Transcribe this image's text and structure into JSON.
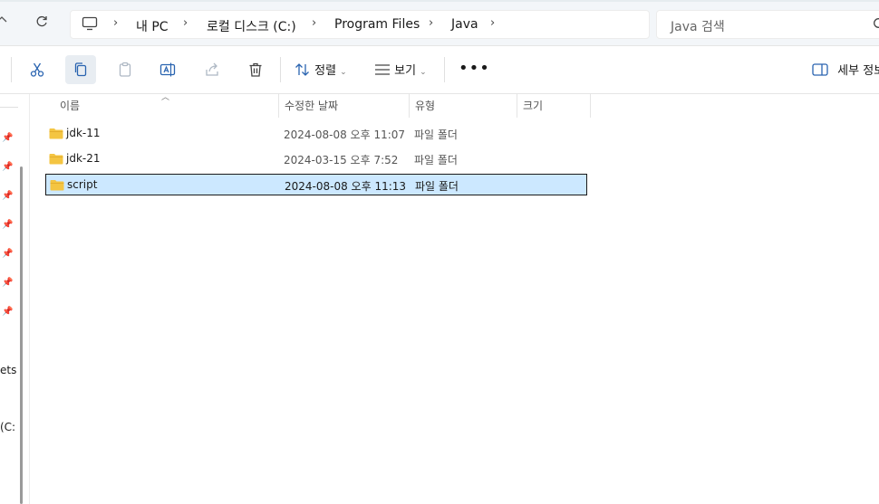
{
  "address_bar": {
    "crumbs": [
      "내 PC",
      "로컬 디스크 (C:)",
      "Program Files",
      "Java"
    ]
  },
  "search": {
    "placeholder": "Java 검색"
  },
  "toolbar": {
    "sort_label": "정렬",
    "view_label": "보기",
    "more_label": "•••",
    "details_label": "세부 정보"
  },
  "left_nav": {
    "fragments": [
      "ets",
      "(C:"
    ]
  },
  "columns": {
    "name": "이름",
    "date": "수정한 날짜",
    "type": "유형",
    "size": "크기"
  },
  "files": [
    {
      "name": "jdk-11",
      "date": "2024-08-08 오후 11:07",
      "type": "파일 폴더",
      "size": ""
    },
    {
      "name": "jdk-21",
      "date": "2024-03-15 오후 7:52",
      "type": "파일 폴더",
      "size": ""
    },
    {
      "name": "script",
      "date": "2024-08-08 오후 11:13",
      "type": "파일 폴더",
      "size": "",
      "selected": true
    }
  ],
  "colors": {
    "selection": "#cce8ff",
    "folder": "#f4c542",
    "accent": "#0067c0"
  }
}
